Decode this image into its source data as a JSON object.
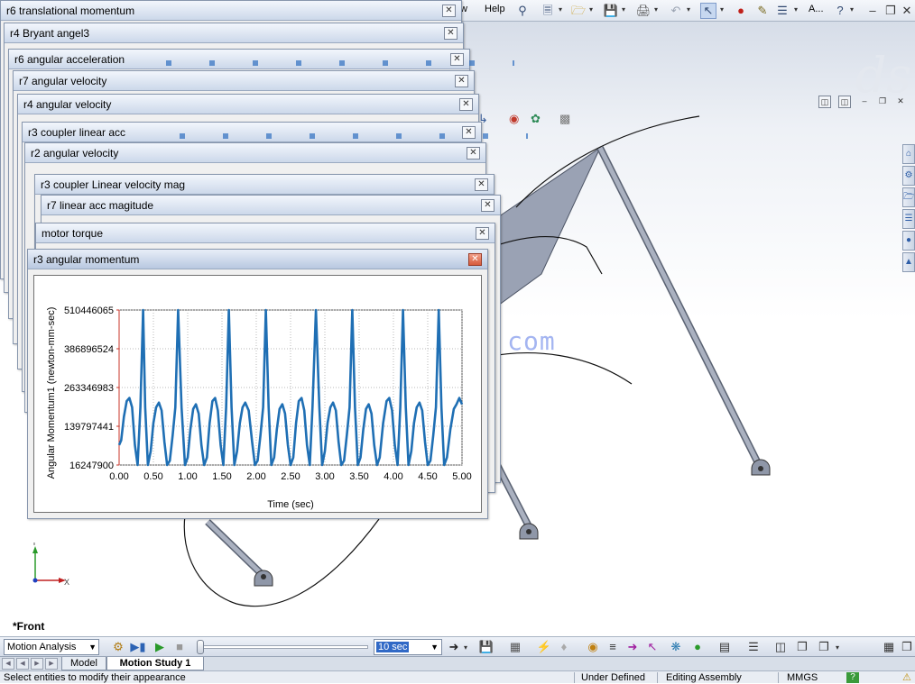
{
  "menu": {
    "items": [
      {
        "label": "View",
        "partial": "w"
      },
      {
        "label": "Help"
      }
    ],
    "zoom_label": "A..."
  },
  "viewport": {
    "view_label": "*Front",
    "watermark": "www.mfcadmox.com",
    "triad": {
      "y": "Y",
      "x": "X"
    }
  },
  "graph_windows": [
    {
      "title": "r6 translational momentum"
    },
    {
      "title": "r4 Bryant angel3"
    },
    {
      "title": "r6 angular acceleration"
    },
    {
      "title": "r7 angular velocity"
    },
    {
      "title": "r4 angular velocity"
    },
    {
      "title": "r3 coupler linear acc"
    },
    {
      "title": "r2 angular velocity"
    },
    {
      "title": "r3 coupler Linear velocity mag"
    },
    {
      "title": "r7 linear acc magitude"
    },
    {
      "title": "motor torque"
    },
    {
      "title": "r3 angular momentum",
      "active": true
    }
  ],
  "chart_data": {
    "type": "line",
    "title": "",
    "xlabel": "Time (sec)",
    "ylabel": "Angular Momentum1 (newton-mm-sec)",
    "xlim": [
      0,
      5
    ],
    "ylim": [
      16247900,
      510446065
    ],
    "xticks": [
      0.0,
      0.5,
      1.0,
      1.5,
      2.0,
      2.5,
      3.0,
      3.5,
      4.0,
      4.5,
      5.0
    ],
    "xtick_labels": [
      "0.00",
      "0.50",
      "1.00",
      "1.50",
      "2.00",
      "2.50",
      "3.00",
      "3.50",
      "4.00",
      "4.50",
      "5.00"
    ],
    "yticks": [
      16247900,
      139797441,
      263346983,
      386896524,
      510446065
    ],
    "ytick_labels": [
      "16247900",
      "139797441",
      "263346983",
      "386896524",
      "510446065"
    ],
    "grid": true,
    "series": [
      {
        "color": "#1f6fb4",
        "x": [
          0.0,
          0.03,
          0.07,
          0.11,
          0.15,
          0.19,
          0.23,
          0.27,
          0.31,
          0.35,
          0.38,
          0.42,
          0.46,
          0.5,
          0.54,
          0.58,
          0.62,
          0.66,
          0.7,
          0.74,
          0.78,
          0.82,
          0.86,
          0.91,
          0.96,
          1.0,
          1.04,
          1.08,
          1.12,
          1.16,
          1.2,
          1.24,
          1.28,
          1.32,
          1.36,
          1.4,
          1.44,
          1.48,
          1.52,
          1.56,
          1.6,
          1.64,
          1.68,
          1.72,
          1.76,
          1.8,
          1.84,
          1.89,
          1.94,
          1.98,
          2.02,
          2.06,
          2.1,
          2.14,
          2.18,
          2.22,
          2.26,
          2.3,
          2.34,
          2.38,
          2.42,
          2.46,
          2.5,
          2.54,
          2.58,
          2.62,
          2.66,
          2.7,
          2.74,
          2.78,
          2.82,
          2.87,
          2.92,
          2.96,
          3.0,
          3.04,
          3.08,
          3.12,
          3.16,
          3.2,
          3.24,
          3.28,
          3.32,
          3.36,
          3.4,
          3.44,
          3.48,
          3.52,
          3.56,
          3.6,
          3.64,
          3.68,
          3.72,
          3.76,
          3.8,
          3.85,
          3.9,
          3.94,
          3.98,
          4.02,
          4.06,
          4.1,
          4.14,
          4.18,
          4.22,
          4.26,
          4.3,
          4.34,
          4.38,
          4.42,
          4.46,
          4.5,
          4.54,
          4.58,
          4.62,
          4.66,
          4.7,
          4.74,
          4.78,
          4.83,
          4.88,
          4.92,
          4.96,
          5.0
        ],
        "y": [
          80000000,
          95000000,
          170000000,
          220000000,
          230000000,
          200000000,
          80000000,
          16247900,
          200000000,
          510446065,
          200000000,
          16247900,
          60000000,
          150000000,
          200000000,
          215000000,
          190000000,
          90000000,
          16247900,
          30000000,
          110000000,
          200000000,
          510446065,
          200000000,
          16247900,
          40000000,
          130000000,
          195000000,
          210000000,
          180000000,
          80000000,
          16247900,
          40000000,
          150000000,
          220000000,
          230000000,
          190000000,
          80000000,
          16247900,
          200000000,
          510446065,
          200000000,
          16247900,
          60000000,
          150000000,
          200000000,
          215000000,
          190000000,
          90000000,
          16247900,
          30000000,
          110000000,
          200000000,
          510446065,
          200000000,
          16247900,
          40000000,
          130000000,
          195000000,
          210000000,
          180000000,
          80000000,
          16247900,
          40000000,
          150000000,
          220000000,
          230000000,
          190000000,
          80000000,
          16247900,
          200000000,
          510446065,
          200000000,
          16247900,
          60000000,
          150000000,
          200000000,
          215000000,
          190000000,
          90000000,
          16247900,
          30000000,
          110000000,
          200000000,
          510446065,
          200000000,
          16247900,
          40000000,
          130000000,
          195000000,
          210000000,
          180000000,
          80000000,
          16247900,
          40000000,
          150000000,
          220000000,
          230000000,
          190000000,
          80000000,
          16247900,
          200000000,
          510446065,
          200000000,
          16247900,
          60000000,
          150000000,
          200000000,
          215000000,
          190000000,
          90000000,
          16247900,
          30000000,
          110000000,
          200000000,
          510446065,
          200000000,
          16247900,
          40000000,
          130000000,
          195000000,
          210000000,
          230000000,
          210000000
        ]
      }
    ]
  },
  "motion_manager": {
    "study_type": "Motion Analysis",
    "playback_speed": "10 sec"
  },
  "tabs": [
    {
      "label": "Model",
      "active": false
    },
    {
      "label": "Motion Study 1",
      "active": true
    }
  ],
  "status": {
    "message": "Select entities to modify their appearance",
    "definition": "Under Defined",
    "mode": "Editing Assembly",
    "units": "MMGS",
    "help": "?"
  },
  "icons": {
    "toolbar": [
      "key-icon",
      "new-document-icon",
      "open-folder-icon",
      "save-icon",
      "print-icon",
      "undo-icon",
      "select-arrow-icon",
      "traffic-light-icon",
      "options-icon",
      "list-icon",
      "help-icon"
    ],
    "window_controls": [
      "minimize-icon",
      "restore-icon",
      "close-icon"
    ]
  },
  "colors": {
    "series": "#1f6fb4",
    "grid": "#b8b8b8",
    "axis_accent": "#c8342a",
    "title_gradient_top": "#f2f6fc",
    "title_gradient_bottom": "#ccd8ea"
  }
}
